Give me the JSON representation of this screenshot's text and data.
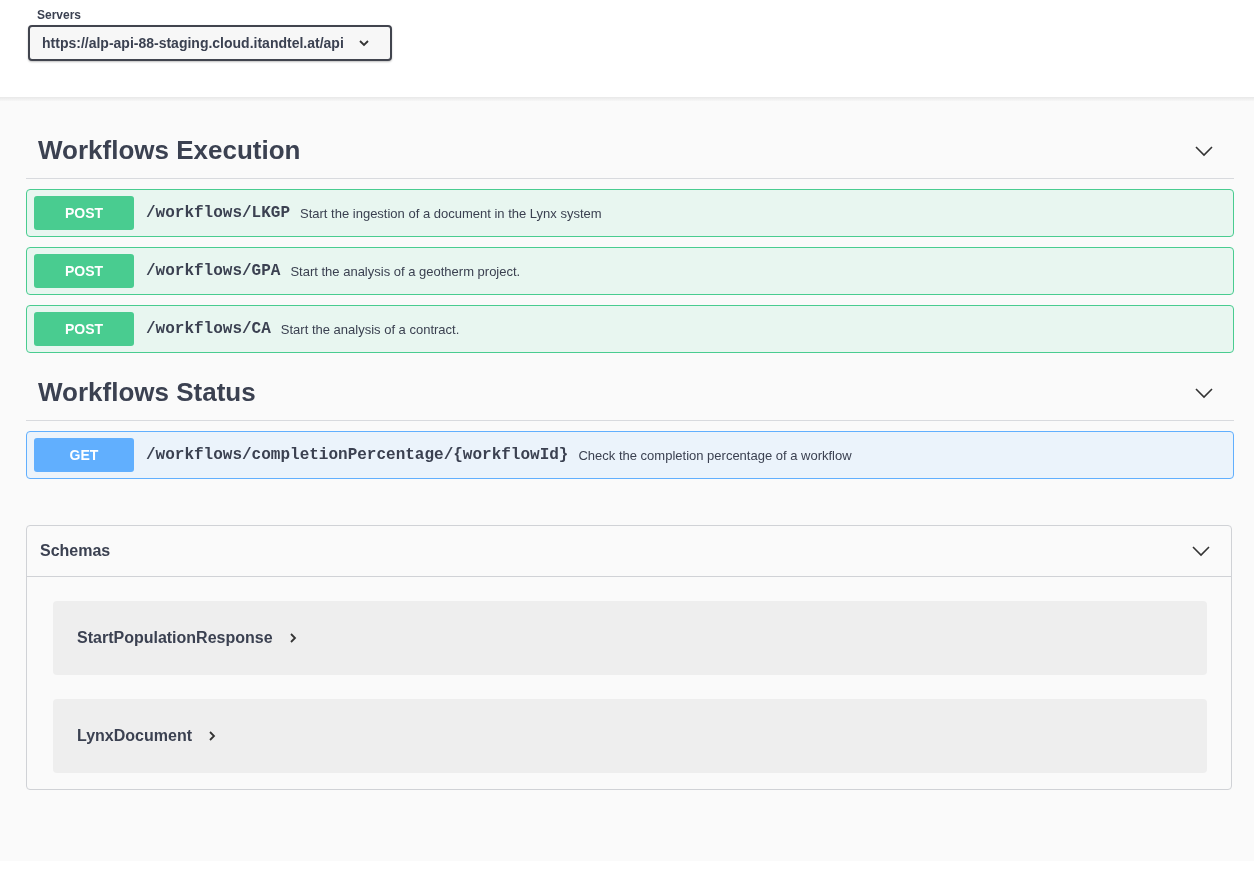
{
  "servers": {
    "label": "Servers",
    "value": "https://alp-api-88-staging.cloud.itandtel.at/api"
  },
  "sections": [
    {
      "title": "Workflows Execution",
      "operations": [
        {
          "method": "POST",
          "path": "/workflows/LKGP",
          "summary": "Start the ingestion of a document in the Lynx system"
        },
        {
          "method": "POST",
          "path": "/workflows/GPA",
          "summary": "Start the analysis of a geotherm project."
        },
        {
          "method": "POST",
          "path": "/workflows/CA",
          "summary": "Start the analysis of a contract."
        }
      ]
    },
    {
      "title": "Workflows Status",
      "operations": [
        {
          "method": "GET",
          "path": "/workflows/completionPercentage/{workflowId}",
          "summary": "Check the completion percentage of a workflow"
        }
      ]
    }
  ],
  "schemas": {
    "title": "Schemas",
    "models": [
      {
        "name": "StartPopulationResponse"
      },
      {
        "name": "LynxDocument"
      }
    ]
  }
}
